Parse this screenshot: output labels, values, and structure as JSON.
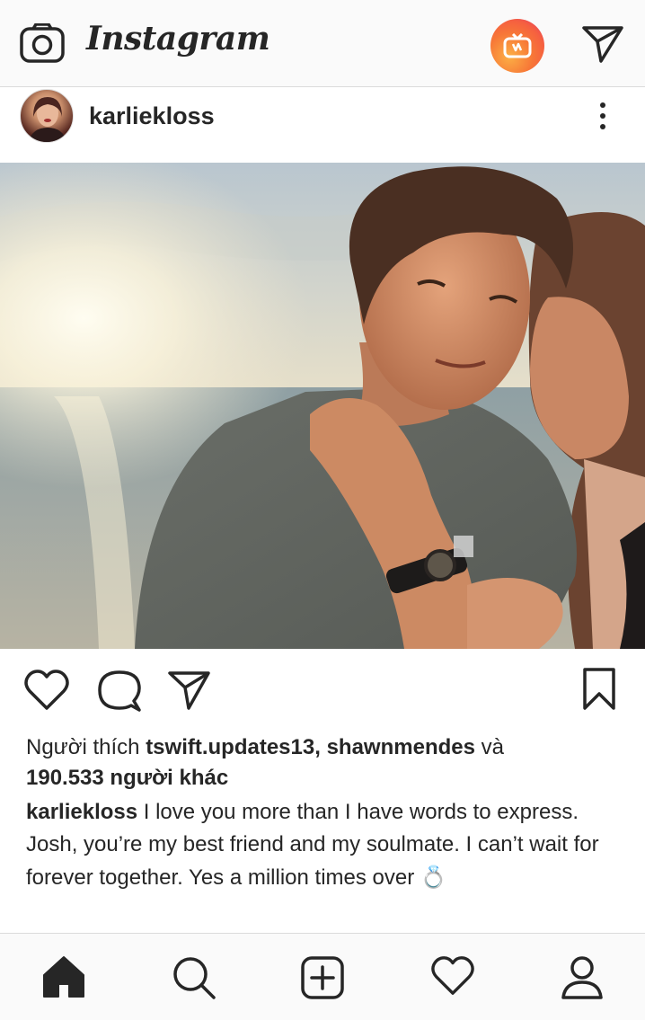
{
  "app": {
    "title": "Instagram"
  },
  "topbar": {
    "logo_text": "Instagram",
    "icons": [
      "camera-icon",
      "igtv-icon",
      "direct-message-icon"
    ]
  },
  "post": {
    "username": "karliekloss",
    "actions": [
      "like-heart-icon",
      "comment-icon",
      "share-icon",
      "save-bookmark-icon"
    ],
    "likes": {
      "prefix": "Người thích",
      "user1": "tswift.updates13",
      "separator": ",",
      "user2": "shawnmendes",
      "conjunction": "và",
      "count": "190.533 người khác"
    },
    "caption": {
      "author": "karliekloss",
      "text": "I love you more than I have words to express. Josh, you’re my best friend and my soulmate. I can’t wait for forever together. Yes a million times over",
      "emoji": "💍"
    }
  },
  "bottom_nav": [
    "home-icon",
    "search-icon",
    "new-post-icon",
    "activity-heart-icon",
    "profile-icon"
  ],
  "colors": {
    "text": "#262626",
    "border": "#dbdbdb",
    "bar_bg": "#fafafa",
    "igtv_orange": "#f77737",
    "igtv_pink": "#e1306c"
  }
}
